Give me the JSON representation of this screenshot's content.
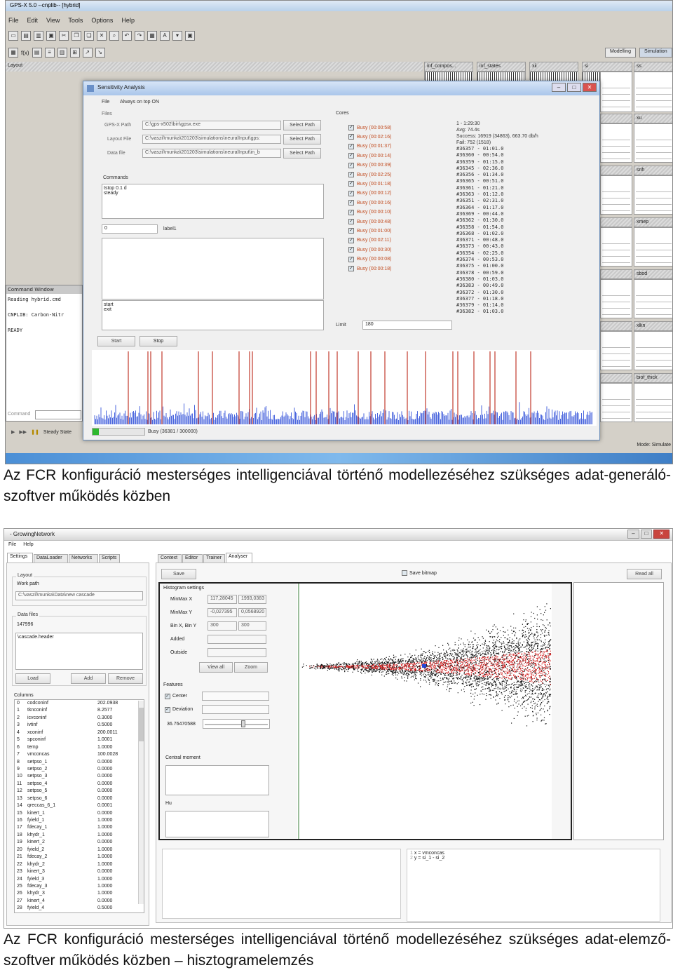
{
  "shot1": {
    "title": "GPS-X 5.0 --cnplib-- [hybrid]",
    "menu": [
      "File",
      "Edit",
      "View",
      "Tools",
      "Options",
      "Help"
    ],
    "toolbar_icon": "toolbar-icon",
    "fx_label": "f(x)",
    "mode_buttons": [
      "Modelling",
      "Simulation"
    ],
    "layout_label": "Layout",
    "panes": [
      "inf_compos...",
      "inf_states",
      "xii",
      "si",
      "ss",
      "xu",
      "snh",
      "xmep",
      "sbod",
      "xlkn",
      "bas",
      "biof_thick"
    ],
    "command_window": {
      "header": "Command Window",
      "lines": [
        "Reading hybrid.cmd",
        "CNPLIB: Carbon-Nitr",
        "READY"
      ],
      "command_label": "Command"
    },
    "dialog": {
      "title": "Sensitivity Analysis",
      "menu_file": "File",
      "menu_on_top": "Always on top ON",
      "files_label": "Files",
      "rows": [
        {
          "label": "GPS-X Path",
          "value": "C:\\gps-x502\\bin\\gpsx.exe",
          "button": "Select Path"
        },
        {
          "label": "Layout File",
          "value": "C:\\vaszil\\munka\\201203\\simulations\\neuralInput\\gps:",
          "button": "Select Path"
        },
        {
          "label": "Data file",
          "value": "C:\\vaszil\\munka\\201203\\simulations\\neuralInput\\in_b",
          "button": "Select Path"
        }
      ],
      "commands_label": "Commands",
      "commands_text": [
        "tstop 0.1 d",
        "steady"
      ],
      "spin_value": "0",
      "label1": "label1",
      "start_exit": [
        "start",
        "exit"
      ],
      "start_btn": "Start",
      "stop_btn": "Stop",
      "cores_label": "Cores",
      "cores": [
        "Busy (00:00:58)",
        "Busy (00:02:16)",
        "Busy (00:01:37)",
        "Busy (00:00:14)",
        "Busy (00:00:39)",
        "Busy (00:02:25)",
        "Busy (00:01:18)",
        "Busy (00:00:12)",
        "Busy (00:00:16)",
        "Busy (00:00:10)",
        "Busy (00:00:48)",
        "Busy (00:01:00)",
        "Busy (00:02:11)",
        "Busy (00:00:30)",
        "Busy (00:00:08)",
        "Busy (00:00:18)"
      ],
      "limit_label": "Limit",
      "limit_value": "180",
      "stats": [
        "1 - 1:29:30",
        "Avg: 74.4s",
        "Success: 16919 (34863), 663.70 db/h",
        "Fail: 752 (1518)"
      ],
      "jobs": [
        "#36357  - 01:01.0",
        "#36360  - 00:54.0",
        "#36359  - 01:15.0",
        "#36345  - 02:36.0",
        "#36356  - 01:34.0",
        "#36365  - 00:51.0",
        "#36361  - 01:21.0",
        "#36363  - 01:12.0",
        "#36351  - 02:31.0",
        "#36364  - 01:17.0",
        "#36369  - 00:44.0",
        "#36362  - 01:30.0",
        "#36358  - 01:54.0",
        "#36368  - 01:02.0",
        "#36371  - 00:48.0",
        "#36373  - 00:43.0",
        "#36354  - 02:25.0",
        "#36374  - 00:53.0",
        "#36375  - 01:00.0",
        "#36378  - 00:59.0",
        "#36380  - 01:03.0",
        "#36383  - 00:49.0",
        "#36372  - 01:30.0",
        "#36377  - 01:18.0",
        "#36379  - 01:14.0",
        "#36382  - 01:03.0"
      ],
      "progress_text": "Busy (36381 / 300000)",
      "progress_fraction": 0.121
    },
    "steady_state": "Steady State",
    "mode_status": "Mode: Simulate",
    "accent": "#c0392b"
  },
  "caption1": "Az FCR konfiguráció mesterséges intelligenciával történő modellezéséhez szükséges adat-generáló-szoftver működés közben",
  "shot2": {
    "title": "- GrowingNetwork",
    "menu": [
      "File",
      "Help"
    ],
    "left_tabs": [
      "Settings",
      "DataLoader",
      "Networks",
      "Scripts"
    ],
    "layout_label": "Layout",
    "work_path_label": "Work path",
    "work_path": "C:\\vaszil\\munka\\Data\\new cascade",
    "data_files_label": "Data files",
    "data_count": "147996",
    "data_file": "\\cascade.header",
    "btn_load": "Load",
    "btn_add": "Add",
    "btn_remove": "Remove",
    "columns_label": "Columns",
    "columns": [
      [
        "0",
        "codconinf",
        "202.0938"
      ],
      [
        "1",
        "tknconinf",
        "8.2577"
      ],
      [
        "2",
        "icvconinf",
        "0.3000"
      ],
      [
        "3",
        "ivtinf",
        "0.5000"
      ],
      [
        "4",
        "xconinf",
        "200.0011"
      ],
      [
        "5",
        "spconinf",
        "1.0001"
      ],
      [
        "6",
        "temp",
        "1.0000"
      ],
      [
        "7",
        "vmconcas",
        "100.0028"
      ],
      [
        "8",
        "setpso_1",
        "0.0000"
      ],
      [
        "9",
        "setpso_2",
        "0.0000"
      ],
      [
        "10",
        "setpso_3",
        "0.0000"
      ],
      [
        "11",
        "setpso_4",
        "0.0000"
      ],
      [
        "12",
        "setpso_5",
        "0.0000"
      ],
      [
        "13",
        "setpso_6",
        "0.0000"
      ],
      [
        "14",
        "qreccas_6_1",
        "0.0001"
      ],
      [
        "15",
        "kinert_1",
        "0.0000"
      ],
      [
        "16",
        "fyield_1",
        "1.0000"
      ],
      [
        "17",
        "fdecay_1",
        "1.0000"
      ],
      [
        "18",
        "khydr_1",
        "1.0000"
      ],
      [
        "19",
        "kinert_2",
        "0.0000"
      ],
      [
        "20",
        "fyield_2",
        "1.0000"
      ],
      [
        "21",
        "fdecay_2",
        "1.0000"
      ],
      [
        "22",
        "khydr_2",
        "1.0000"
      ],
      [
        "23",
        "kinert_3",
        "0.0000"
      ],
      [
        "24",
        "fyield_3",
        "1.0000"
      ],
      [
        "25",
        "fdecay_3",
        "1.0000"
      ],
      [
        "26",
        "khydr_3",
        "1.0000"
      ],
      [
        "27",
        "kinert_4",
        "0.0000"
      ],
      [
        "28",
        "fyield_4",
        "0.5000"
      ]
    ],
    "right_tabs": [
      "Context",
      "Editor",
      "Trainer",
      "Analyser"
    ],
    "save_btn": "Save",
    "save_bitmap": "Save bitmap",
    "read_all": "Read all",
    "hist_label": "Histogram settings",
    "minmax_x_label": "MinMax X",
    "minmax_x": [
      "117,28045",
      "1993,0383"
    ],
    "minmax_y_label": "MinMax Y",
    "minmax_y": [
      "-0,027395",
      "0,0568920"
    ],
    "bin_label": "Bin X, Bin Y",
    "bins": [
      "300",
      "300"
    ],
    "added_label": "Added",
    "outside_label": "Outside",
    "view_all": "View all",
    "zoom": "Zoom",
    "features_label": "Features",
    "center_label": "Center",
    "deviation_label": "Deviation",
    "slider_value": "36.76470588",
    "slider_fraction": 0.62,
    "central_moment": "Central moment",
    "hu_label": "Hu",
    "script_lines": [
      [
        "1",
        "x = vmconcas"
      ],
      [
        "2",
        "y = si_1 - si_2"
      ]
    ]
  },
  "caption2": "Az FCR konfiguráció mesterséges intelligenciával történő modellezéséhez szükséges adat-elemző-szoftver működés közben – hisztogramelemzés"
}
